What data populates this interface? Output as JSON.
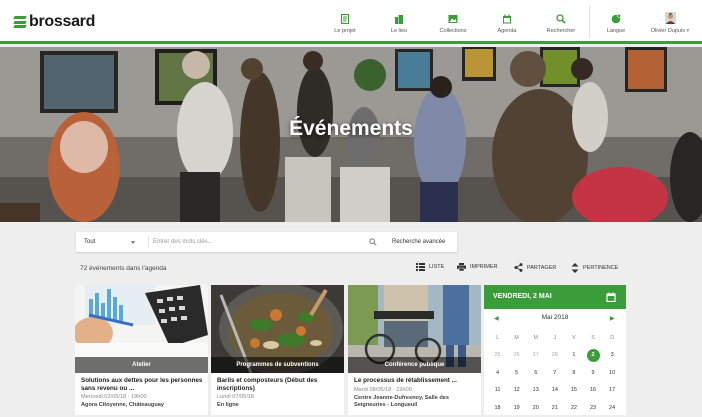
{
  "brand": {
    "name": "brossard"
  },
  "nav": {
    "items": [
      {
        "label": "Le projet",
        "icon": "document-icon"
      },
      {
        "label": "Le lieu",
        "icon": "building-icon"
      },
      {
        "label": "Collections",
        "icon": "image-icon"
      },
      {
        "label": "Agenda",
        "icon": "calendar-icon"
      },
      {
        "label": "Rechercher",
        "icon": "search-icon"
      }
    ],
    "language_label": "Langue",
    "user_label": "Olivier Dupuis"
  },
  "hero": {
    "title": "Événements"
  },
  "search": {
    "category": "Tout",
    "placeholder": "Entrer des mots clés...",
    "advanced_label": "Recherche avancée"
  },
  "results": {
    "count_text": "72 événements dans l'agenda"
  },
  "toolbar": {
    "list_label": "LISTE",
    "print_label": "IMPRIMER",
    "share_label": "PARTAGER",
    "sort_label": "PERTINENCE"
  },
  "cards": [
    {
      "tag": "Atelier",
      "title": "Solutions aux dettes pour les personnes sans revenu ou ...",
      "date": "Mercredi 02/05/18 · 19h00",
      "place": "Agora Citoyenne, Châteauguay"
    },
    {
      "tag": "Programmes de subventions",
      "title": "Barils et composteurs (Début des inscriptions)",
      "date": "Lundi 07/05/18",
      "place": "En ligne"
    },
    {
      "tag": "Conférence publique",
      "title": "Le processus de rétablissement ...",
      "date": "Mardi 08/05/18 · 19h00",
      "place": "Centre Jeanne-Dufresnoy, Salle des Seigneuries - Longueuil"
    }
  ],
  "calendar": {
    "header": "VENDREDI, 2 MAI",
    "month": "Mai 2018",
    "weekdays": [
      "L",
      "M",
      "M",
      "J",
      "V",
      "S",
      "D"
    ],
    "weeks": [
      [
        "25",
        "26",
        "27",
        "28",
        "1",
        "2",
        "3"
      ],
      [
        "4",
        "5",
        "6",
        "7",
        "8",
        "9",
        "10"
      ],
      [
        "11",
        "12",
        "13",
        "14",
        "15",
        "16",
        "17"
      ],
      [
        "18",
        "19",
        "20",
        "21",
        "22",
        "23",
        "24"
      ]
    ],
    "selected": "2"
  },
  "colors": {
    "accent": "#3a9d3a",
    "topbar": "#ffffff",
    "page": "#eeeeee"
  }
}
